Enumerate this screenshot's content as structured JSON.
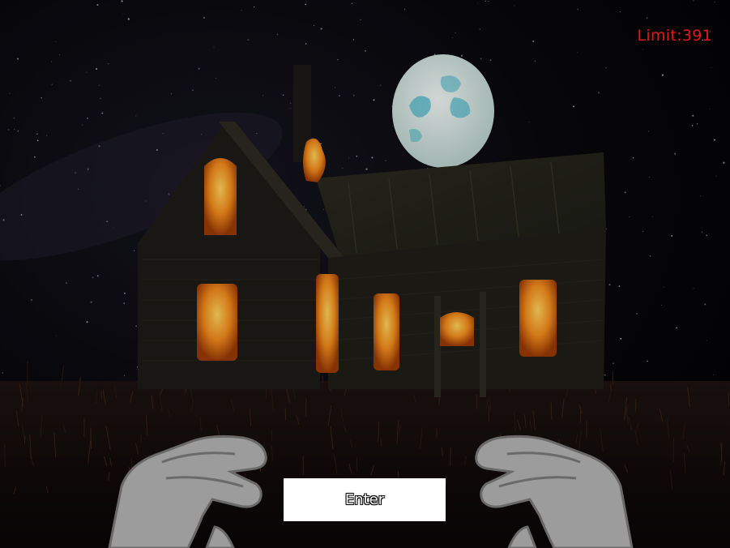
{
  "hud": {
    "limit_label": "Limit:",
    "limit_value": "391"
  },
  "enter_button": {
    "label": "Enter"
  },
  "scene": {
    "description_icons": [
      "moon-icon",
      "haunted-house-icon",
      "left-hand-icon",
      "right-hand-icon"
    ],
    "colors": {
      "sky": "#07070b",
      "moon": "#d8e6e2",
      "moon_spots": "#4fb6c8",
      "fire": "#f08a1c",
      "limit_text": "#e01818",
      "hands": "#9c9c9c"
    }
  }
}
